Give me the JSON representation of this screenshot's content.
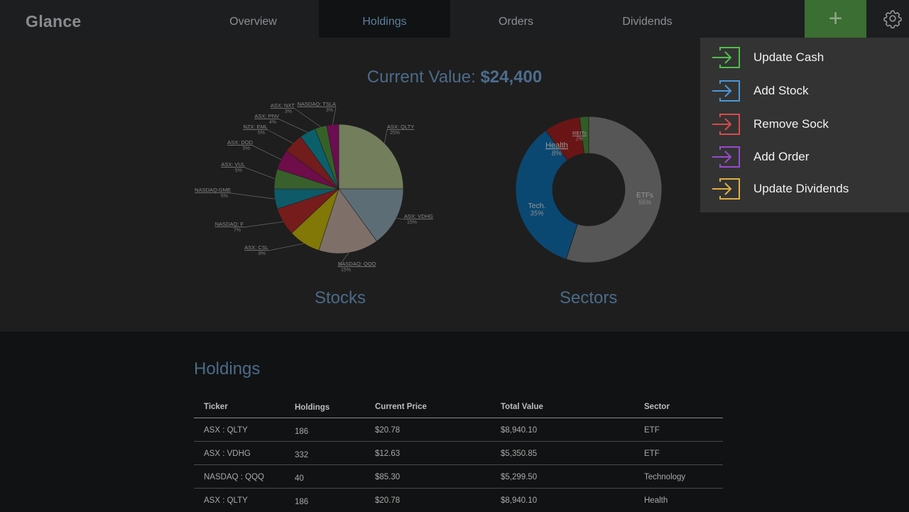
{
  "app": {
    "title": "Glance"
  },
  "nav": {
    "tabs": [
      {
        "label": "Overview"
      },
      {
        "label": "Holdings"
      },
      {
        "label": "Orders"
      },
      {
        "label": "Dividends"
      }
    ],
    "active_tab": "Holdings",
    "add_button": "+",
    "settings_icon": "gear-icon"
  },
  "summary": {
    "prefix": "Current Value: ",
    "value": "$24,400"
  },
  "charts": {
    "stocks_title": "Stocks",
    "sectors_title": "Sectors"
  },
  "menu": {
    "items": [
      {
        "label": "Update Cash",
        "icon": "enter-icon",
        "color": "#4fbf4a"
      },
      {
        "label": "Add Stock",
        "icon": "enter-icon",
        "color": "#4a98d8"
      },
      {
        "label": "Remove Sock",
        "icon": "enter-icon",
        "color": "#d84a4a"
      },
      {
        "label": "Add Order",
        "icon": "enter-icon",
        "color": "#9a4ad0"
      },
      {
        "label": "Update Dividends",
        "icon": "enter-icon",
        "color": "#e0b040"
      }
    ]
  },
  "holdings": {
    "title": "Holdings",
    "columns": [
      "Ticker",
      "Holdings",
      "Current Price",
      "Total Value",
      "Sector"
    ],
    "rows": [
      [
        "ASX : QLTY",
        "186",
        "$20.78",
        "$8,940.10",
        "ETF"
      ],
      [
        "ASX : VDHG",
        "332",
        "$12.63",
        "$5,350.85",
        "ETF"
      ],
      [
        "NASDAQ : QQQ",
        "40",
        "$85.30",
        "$5,299.50",
        "Technology"
      ],
      [
        "ASX : QLTY",
        "186",
        "$20.78",
        "$8,940.10",
        "Health"
      ]
    ]
  },
  "chart_data": [
    {
      "type": "pie",
      "title": "Stocks",
      "slices": [
        {
          "label": "ASX: QLTY",
          "pct_label": "25%",
          "value": 25,
          "color": "#737e5c"
        },
        {
          "label": "ASX: VDHG",
          "pct_label": "15%",
          "value": 15,
          "color": "#5c6d75"
        },
        {
          "label": "NASDAQ: QQQ",
          "pct_label": "15%",
          "value": 15,
          "color": "#7e7068"
        },
        {
          "label": "ASX: CSL",
          "pct_label": "8%",
          "value": 8,
          "color": "#817807"
        },
        {
          "label": "NASDAQ: F",
          "pct_label": "7%",
          "value": 7,
          "color": "#761c1c"
        },
        {
          "label": "NASDAQ:GME",
          "pct_label": "5%",
          "value": 5,
          "color": "#0e5a68"
        },
        {
          "label": "ASX: VUL",
          "pct_label": "5%",
          "value": 5,
          "color": "#395f2d"
        },
        {
          "label": "ASX: DOD",
          "pct_label": "5%",
          "value": 5,
          "color": "#6f0c4a"
        },
        {
          "label": "NZX: EML",
          "pct_label": "5%",
          "value": 5,
          "color": "#721c1c"
        },
        {
          "label": "ASX: PNV",
          "pct_label": "4%",
          "value": 4,
          "color": "#0b5f6b"
        },
        {
          "label": "ASX: NXT",
          "pct_label": "3%",
          "value": 3,
          "color": "#356128"
        },
        {
          "label": "NASDAQ: TSLA",
          "pct_label": "3%",
          "value": 3,
          "color": "#6c0c52"
        }
      ]
    },
    {
      "type": "pie",
      "title": "Sectors",
      "donut": true,
      "slices": [
        {
          "label": "ETFs",
          "pct_label": "55%",
          "value": 55,
          "color": "#565656"
        },
        {
          "label": "Tech.",
          "pct_label": "35%",
          "value": 35,
          "color": "#0a4872"
        },
        {
          "label": "Health",
          "pct_label": "8%",
          "value": 8,
          "color": "#6a1515"
        },
        {
          "label": "REITs",
          "pct_label": "2%",
          "value": 2,
          "color": "#305c25"
        }
      ]
    }
  ]
}
